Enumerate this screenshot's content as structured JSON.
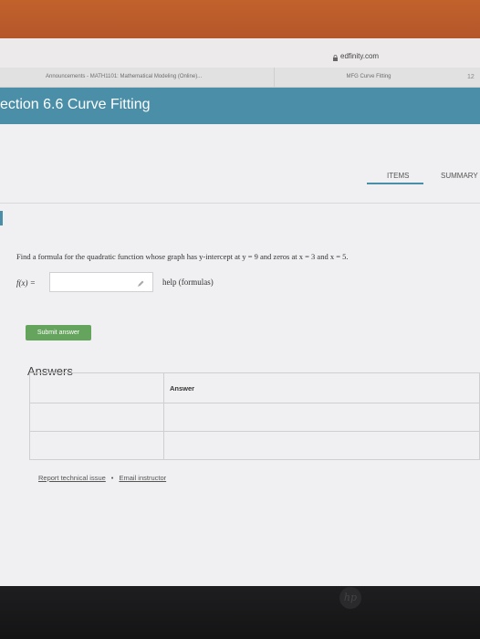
{
  "browser": {
    "url": "edfinity.com",
    "tabs": [
      {
        "label": "Announcements - MATH1101: Mathematical Modeling (Online)..."
      },
      {
        "label": "MFG Curve Fitting"
      }
    ],
    "tab_badge": "12"
  },
  "header": {
    "section_title": "ection 6.6 Curve Fitting"
  },
  "nav": {
    "items_label": "ITEMS",
    "summary_label": "SUMMARY"
  },
  "problem": {
    "prompt": "Find a formula for the quadratic function whose graph has y-intercept at y = 9 and zeros at x = 3 and x = 5.",
    "function_label": "f(x) =",
    "answer_value": "",
    "help_label": "help (formulas)",
    "submit_label": "Submit answer"
  },
  "answers": {
    "heading": "Answers",
    "column_header": "Answer"
  },
  "footer": {
    "report_label": "Report technical issue",
    "separator": "•",
    "email_label": "Email instructor"
  },
  "colors": {
    "header_bg": "#4a8ea7",
    "submit_bg": "#65a45d"
  }
}
